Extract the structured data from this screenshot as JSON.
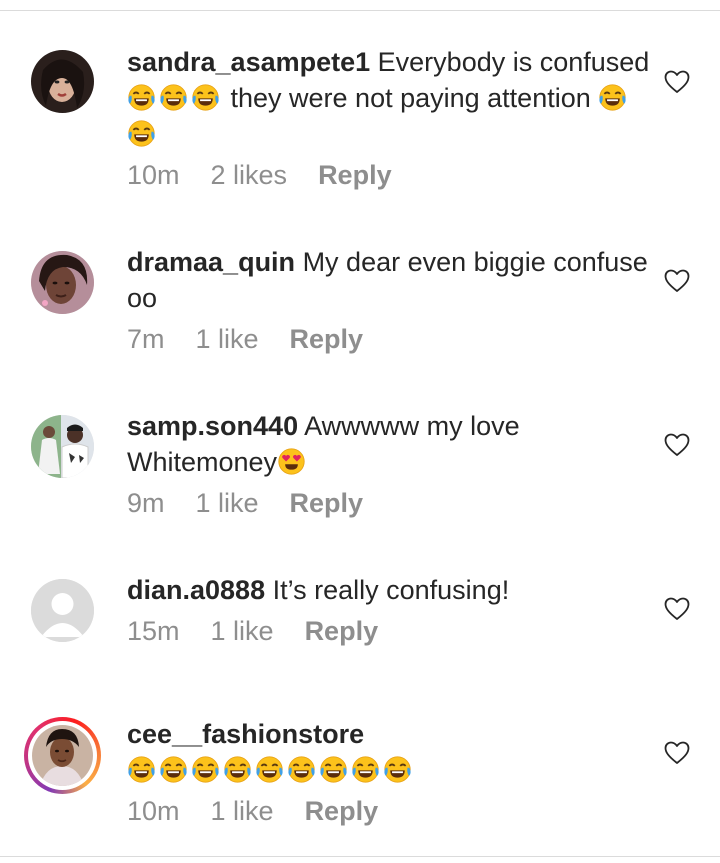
{
  "comments": [
    {
      "username": "sandra_asampete1",
      "segments": [
        {
          "t": "text",
          "v": " Everybody is confused "
        },
        {
          "t": "emoji",
          "name": "joy"
        },
        {
          "t": "emoji",
          "name": "joy"
        },
        {
          "t": "emoji",
          "name": "joy"
        },
        {
          "t": "text",
          "v": " they were not paying attention "
        },
        {
          "t": "emoji",
          "name": "joy"
        },
        {
          "t": "emoji",
          "name": "joy"
        }
      ],
      "time": "10m",
      "likes": "2 likes",
      "reply": "Reply",
      "avatar": "woman-glam"
    },
    {
      "username": "dramaa_quin",
      "segments": [
        {
          "t": "text",
          "v": " My dear even biggie confuse oo"
        }
      ],
      "time": "7m",
      "likes": "1 like",
      "reply": "Reply",
      "avatar": "woman-selfie"
    },
    {
      "username": "samp.son440",
      "segments": [
        {
          "t": "text",
          "v": " Awwwww my love Whitemoney"
        },
        {
          "t": "emoji",
          "name": "heart-eyes"
        }
      ],
      "time": "9m",
      "likes": "1 like",
      "reply": "Reply",
      "avatar": "couple"
    },
    {
      "username": "dian.a0888",
      "segments": [
        {
          "t": "text",
          "v": " It’s really confusing!"
        }
      ],
      "time": "15m",
      "likes": "1 like",
      "reply": "Reply",
      "avatar": "default"
    },
    {
      "username": "cee__fashionstore",
      "segments": [
        {
          "t": "emoji",
          "name": "joy"
        },
        {
          "t": "emoji",
          "name": "joy"
        },
        {
          "t": "emoji",
          "name": "joy"
        },
        {
          "t": "emoji",
          "name": "joy"
        },
        {
          "t": "emoji",
          "name": "joy"
        },
        {
          "t": "emoji",
          "name": "joy"
        },
        {
          "t": "emoji",
          "name": "joy"
        },
        {
          "t": "emoji",
          "name": "joy"
        },
        {
          "t": "emoji",
          "name": "joy"
        }
      ],
      "username_own_line": true,
      "time": "10m",
      "likes": "1 like",
      "reply": "Reply",
      "avatar": "woman-story"
    }
  ],
  "colors": {
    "text": "#262626",
    "meta": "#8e8e8e",
    "divider": "#dbdbdb"
  }
}
